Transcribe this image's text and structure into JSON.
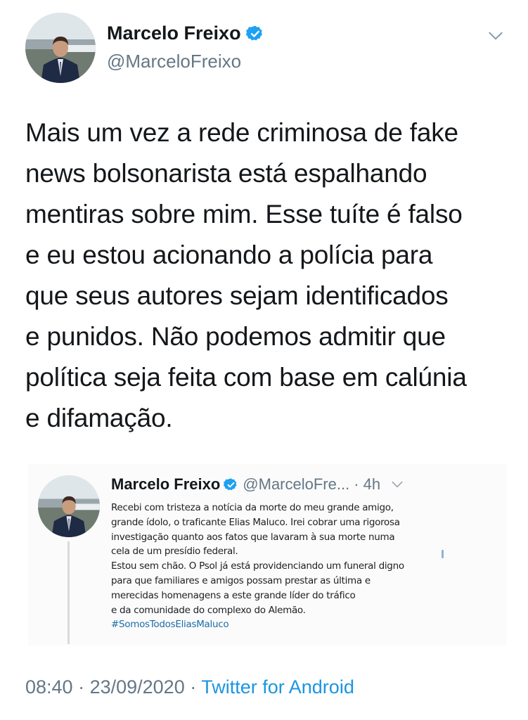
{
  "author": {
    "name": "Marcelo Freixo",
    "handle": "@MarceloFreixo"
  },
  "tweet": {
    "lines": [
      "Mais um vez a rede criminosa de fake",
      "news bolsonarista está espalhando",
      "mentiras sobre mim. Esse tuíte é falso",
      "e eu estou acionando a polícia para",
      "que seus autores sejam identificados",
      "e punidos. Não podemos admitir que",
      "política seja feita com base em calúnia",
      "e difamação."
    ]
  },
  "embedded_tweet": {
    "name": "Marcelo Freixo",
    "handle": "@MarceloFre...",
    "time": "· 4h",
    "lines": [
      "Recebi com tristeza a notícia da morte do meu grande amigo,",
      "grande ídolo, o traficante Elias Maluco. Irei cobrar uma rigorosa",
      "investigação quanto aos fatos que lavaram à sua morte numa",
      "cela de um presídio federal.",
      "Estou sem chão. O Psol já está providenciando um funeral digno",
      "para que familiares e amigos possam prestar as última e",
      "merecidas homenagens a este grande líder do tráfico",
      "e da comunidade do complexo do Alemão."
    ],
    "hashtag": "#SomosTodosEliasMaluco"
  },
  "footer": {
    "time": "08:40",
    "separator": " · ",
    "date": "23/09/2020",
    "source": "Twitter for Android"
  },
  "icons": {
    "verified": "verified-badge-icon",
    "menu": "chevron-down-icon"
  },
  "colors": {
    "verified_blue": "#1da1f2",
    "secondary_text": "#657786",
    "link_blue": "#1b95e0"
  }
}
